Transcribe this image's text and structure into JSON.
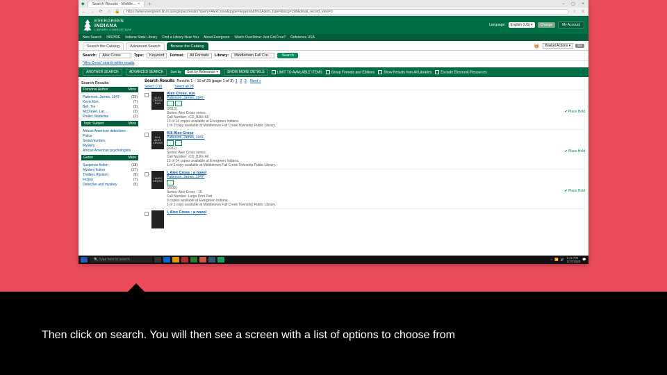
{
  "caption": "Then click on search. You will then see a screen with a list of options to choose from",
  "browser": {
    "tab_title": "Search Results - Middle…",
    "url": "https://www.evergreen.lib.in.us/eg/opac/results?query=AlexCross&qtype=keyword&fi%3Aitem_type=&locg=198&detail_record_view=0",
    "window_buttons": {
      "min": "–",
      "max": "▢",
      "close": "×"
    }
  },
  "header": {
    "logo": {
      "line1": "EVERGREEN",
      "line2": "INDIANA",
      "line3": "LIBRARY CONSORTIUM"
    },
    "language_label": "Language:",
    "language_value": "English (US) ▾",
    "change_btn": "Change",
    "account_btn": "My Account"
  },
  "nav": [
    "New Search",
    "INSPIRE",
    "Indiana State Library",
    "Find a Library Near You",
    "About Evergreen",
    "Watch OverDrive: Just Got Free?",
    "Reference USA"
  ],
  "page_tabs": {
    "search": "Search the Catalog",
    "advanced": "Advanced Search",
    "browse": "Browse the Catalog"
  },
  "basket": {
    "actions": "Basket Actions ▾",
    "go": "Go"
  },
  "searchform": {
    "search_lbl": "Search:",
    "search_val": "Alex Cross",
    "type_lbl": "Type:",
    "type_val": "Keyword",
    "format_lbl": "Format:",
    "format_val": "All Formats",
    "library_lbl": "Library:",
    "library_val": "Middletown Fall Cre…",
    "search_btn": "Search",
    "search_within": "\"Alex Cross\" search within results"
  },
  "filterbar": {
    "another": "ANOTHER SEARCH",
    "advanced": "ADVANCED SEARCH",
    "sort_lbl": "Sort by",
    "sort_val": "Sort by Relevance ▾",
    "more": "SHOW MORE DETAILS",
    "limit": "LIMIT TO AVAILABLE ITEMS",
    "group": "Group Formats and Editions",
    "branch": "Show Results from All Libraries",
    "exclude": "Exclude Electronic Resources"
  },
  "sidebar": {
    "search_results": "Search Results",
    "facets": [
      {
        "title": "Personal Author",
        "more": "More",
        "items": [
          {
            "label": "Patterson, James, 1947-",
            "n": "(25)"
          },
          {
            "label": "Kevin Kim",
            "n": "(7)"
          },
          {
            "label": "Bell, Tre",
            "n": "(3)"
          },
          {
            "label": "McDaniel, Lar…",
            "n": "(3)"
          },
          {
            "label": "Preller, Madeline",
            "n": "(2)"
          }
        ]
      },
      {
        "title": "Topic Subject",
        "more": "More",
        "items": [
          {
            "label": "African American detectives",
            "n": ""
          },
          {
            "label": "Police",
            "n": ""
          },
          {
            "label": "Serial murders",
            "n": ""
          },
          {
            "label": "Mystery",
            "n": ""
          },
          {
            "label": "African American psychologists",
            "n": ""
          }
        ]
      },
      {
        "title": "Genre",
        "more": "More",
        "items": [
          {
            "label": "Suspense fiction",
            "n": "(18)"
          },
          {
            "label": "Mystery fiction",
            "n": "(17)"
          },
          {
            "label": "Thrillers (Fiction)",
            "n": "(9)"
          },
          {
            "label": "Fiction",
            "n": "(7)"
          },
          {
            "label": "Detective and mystery",
            "n": "(5)"
          }
        ]
      }
    ]
  },
  "results": {
    "heading": "Search Results",
    "count_text": "Results 1 – 10 of 29  (page 1 of 3)",
    "pager": [
      "1",
      "2",
      "3"
    ],
    "next": "Next »",
    "select_top": "Select 1-10",
    "select_all": "Select all 29",
    "place_hold": "Place Hold",
    "items": [
      {
        "title": "Alex Cross, run",
        "author": "Patterson, James, 1947-",
        "year": "(2013)",
        "series": "Series: Alex Cross series.",
        "call": "Call Number: ‹CD_BJN› All",
        "avail1": "13 of 14 copies available at Evergreen Indiana.",
        "avail2": "1 of 1 copy available at Middletown Fall Creek Township Public Library."
      },
      {
        "title": "Kill Alex Cross",
        "author": "Patterson, James, 1947-",
        "year": "(2011)",
        "series": "Series: Alex Cross series.",
        "call": "Call Number: ‹CD_BJN› All",
        "avail1": "13 of 14 copies available at Evergreen Indiana.",
        "avail2": "1 of 1 copy available at Middletown Fall Creek Township Public Library."
      },
      {
        "title": "I, Alex Cross : a novel",
        "author": "Patterson, James, 1947-",
        "year": "(2009)",
        "series": "Series: Alex Cross ; 16.",
        "call": "Call Number: Large Print Patt",
        "avail1": "9 copies available at Evergreen Indiana.",
        "avail2": "1 of 1 copy available at Middletown Fall Creek Township Public Library."
      },
      {
        "title": "I, Alex Cross : a novel",
        "author": "",
        "year": "",
        "series": "",
        "call": "",
        "avail1": "",
        "avail2": ""
      }
    ]
  },
  "taskbar": {
    "search_placeholder": "Type here to search",
    "clock": "1:41 PM",
    "date": "1/27/2020"
  }
}
